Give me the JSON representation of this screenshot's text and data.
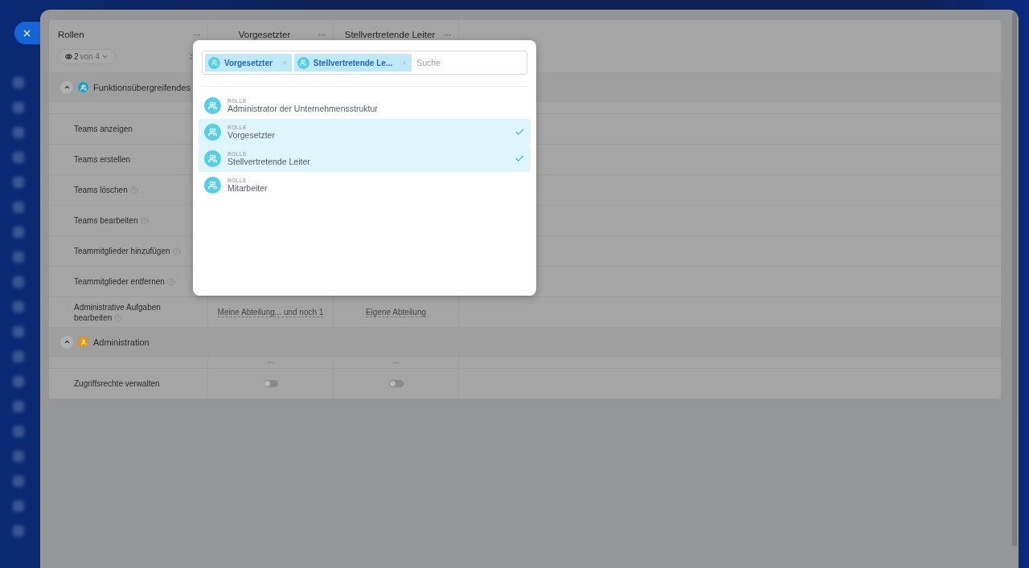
{
  "table": {
    "columns": [
      {
        "title": "Rollen"
      },
      {
        "title": "Vorgesetzter"
      },
      {
        "title": "Stellvertretende Leiter"
      }
    ],
    "filter": {
      "count": "2",
      "suffix": "von 4"
    },
    "sections": [
      {
        "title": "Funktionsübergreifendes",
        "kind": "team",
        "color": "#1ba0c9",
        "expanded": true,
        "column_menus": false,
        "rows": [
          {
            "label": "Teams anzeigen",
            "help": false,
            "cells": []
          },
          {
            "label": "Teams erstellen",
            "help": false,
            "cells": []
          },
          {
            "label": "Teams löschen",
            "help": true,
            "cells": []
          },
          {
            "label": "Teams bearbeiten",
            "help": true,
            "cells": []
          },
          {
            "label": "Teammitglieder hinzufügen",
            "help": true,
            "cells": []
          },
          {
            "label": "Teammitglieder entfernen",
            "help": true,
            "cells": []
          },
          {
            "label": "Administrative Aufgaben bearbeiten",
            "help": true,
            "cells": [
              {
                "kind": "text",
                "text": "Meine Abteilung... und noch 1"
              },
              {
                "kind": "text",
                "text": "Eigene Abteilung"
              }
            ]
          }
        ]
      },
      {
        "title": "Administration",
        "kind": "person",
        "color": "#e0960f",
        "expanded": true,
        "column_menus": true,
        "rows": [
          {
            "label": "Zugriffsrechte verwalten",
            "help": false,
            "cells": [
              {
                "kind": "toggle",
                "on": false
              },
              {
                "kind": "toggle",
                "on": false
              }
            ]
          }
        ]
      }
    ]
  },
  "popup": {
    "chips": [
      {
        "label": "Vorgesetzter"
      },
      {
        "label": "Stellvertretende Le..."
      }
    ],
    "search": {
      "placeholder": "Suche"
    },
    "items": [
      {
        "type_label": "ROLLE",
        "name": "Administrator der Unternehmensstruktur",
        "selected": false
      },
      {
        "type_label": "ROLLE",
        "name": "Vorgesetzter",
        "selected": true
      },
      {
        "type_label": "ROLLE",
        "name": "Stellvertretende Leiter",
        "selected": true
      },
      {
        "type_label": "ROLLE",
        "name": "Mitarbeiter",
        "selected": false
      }
    ]
  }
}
